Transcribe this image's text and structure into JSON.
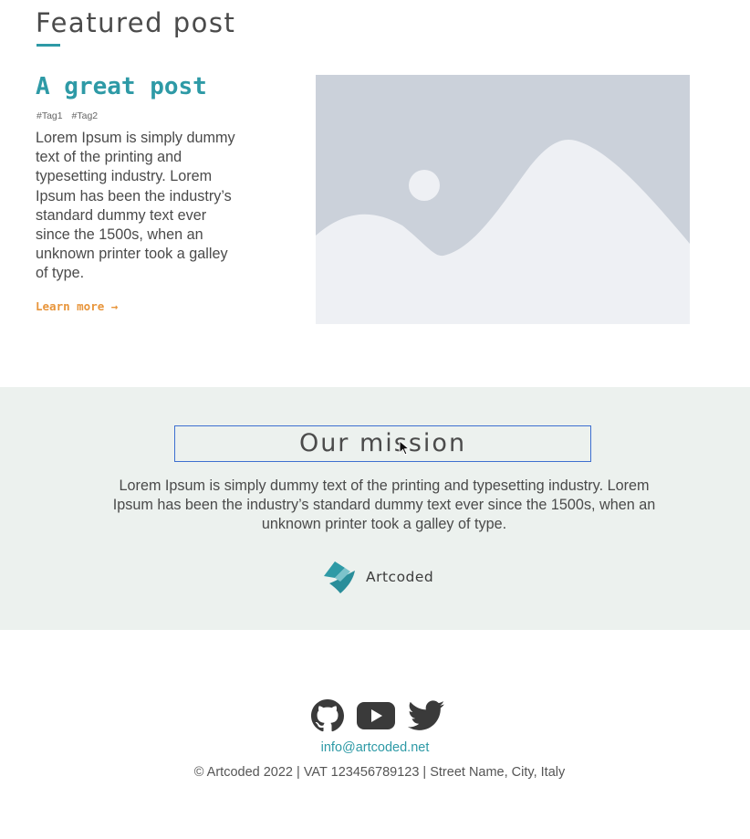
{
  "featured": {
    "heading": "Featured post",
    "post_title": "A great post",
    "tags": [
      "#Tag1",
      "#Tag2"
    ],
    "body": "Lorem Ipsum is simply dummy text of the printing and typesetting industry. Lorem Ipsum has been the industry’s standard dummy text ever since the 1500s, when an unknown printer took a galley of type.",
    "learn_more": "Learn more →"
  },
  "mission": {
    "title": "Our mission",
    "text": "Lorem Ipsum is simply dummy text of the printing and typesetting industry. Lorem Ipsum has been the industry’s standard dummy text ever since the 1500s, when an unknown printer took a galley of type.",
    "brand_name": "Artcoded"
  },
  "footer": {
    "socials": [
      "github-icon",
      "youtube-icon",
      "twitter-icon"
    ],
    "email": "info@artcoded.net",
    "legal": "© Artcoded 2022  |  VAT 123456789123 |  Street Name, City, Italy"
  },
  "colors": {
    "accent": "#2e9aa6",
    "link_orange": "#e8953b",
    "mission_bg": "#ecf1ee",
    "placeholder_bg": "#cbd1da"
  }
}
